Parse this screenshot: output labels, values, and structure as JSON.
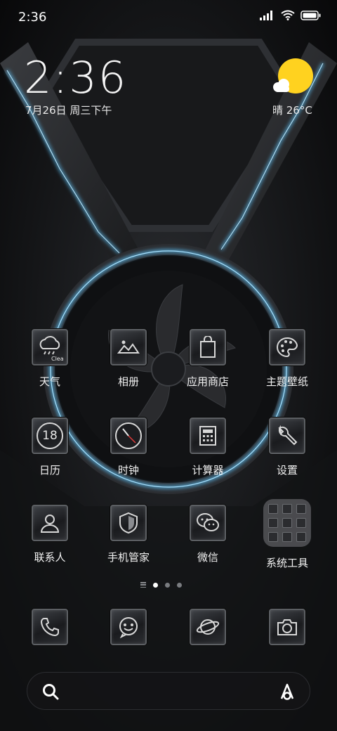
{
  "status_bar": {
    "time": "2:36"
  },
  "clock_widget": {
    "time": "2:36",
    "date": "7月26日 周三下午",
    "weather": "晴 26°C",
    "weather_icon_small_text": "Clea"
  },
  "apps": [
    {
      "label": "天气",
      "icon": "weather-icon"
    },
    {
      "label": "相册",
      "icon": "gallery-icon"
    },
    {
      "label": "应用商店",
      "icon": "app-store-icon"
    },
    {
      "label": "主题壁纸",
      "icon": "theme-palette-icon"
    },
    {
      "label": "日历",
      "icon": "calendar-icon",
      "icon_text": "18"
    },
    {
      "label": "时钟",
      "icon": "clock-icon"
    },
    {
      "label": "计算器",
      "icon": "calculator-icon"
    },
    {
      "label": "设置",
      "icon": "settings-wrench-icon"
    },
    {
      "label": "联系人",
      "icon": "contacts-icon"
    },
    {
      "label": "手机管家",
      "icon": "security-shield-icon"
    },
    {
      "label": "微信",
      "icon": "wechat-icon"
    },
    {
      "label": "系统工具",
      "icon": "folder-icon"
    }
  ],
  "dock": [
    {
      "icon": "phone-icon"
    },
    {
      "icon": "messages-icon"
    },
    {
      "icon": "browser-planet-icon"
    },
    {
      "icon": "camera-icon"
    }
  ],
  "page_indicator": {
    "pages": 3,
    "active": 1
  },
  "colors": {
    "accent_glow": "#5ec8ff",
    "sun": "#ffd21f"
  }
}
